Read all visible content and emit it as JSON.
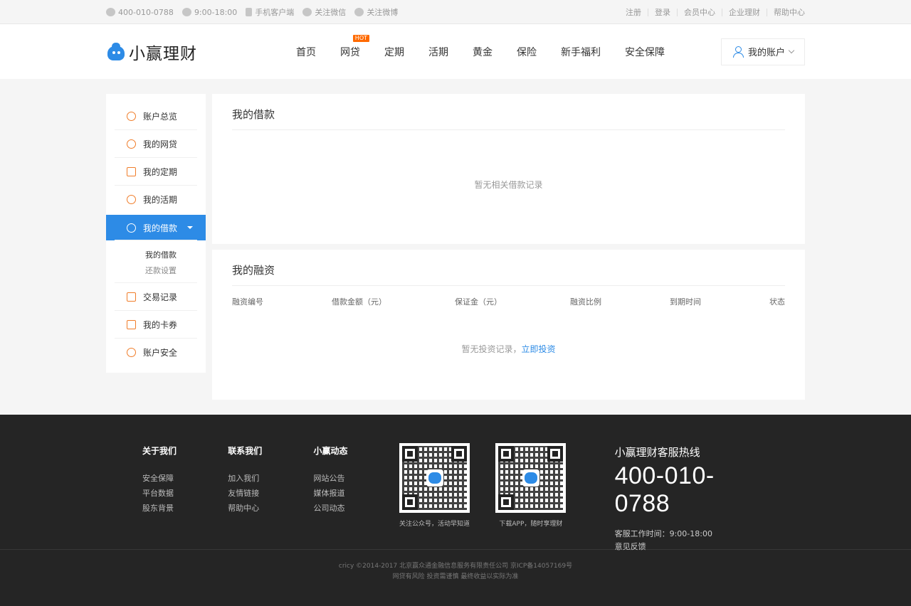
{
  "topbar": {
    "phone": "400-010-0788",
    "hours": "9:00-18:00",
    "mobile_client": "手机客户端",
    "wechat": "关注微信",
    "weibo": "关注微博",
    "links": [
      "注册",
      "登录",
      "会员中心",
      "企业理财",
      "帮助中心"
    ]
  },
  "header": {
    "logo_text": "小赢理财",
    "nav": [
      "首页",
      "网贷",
      "定期",
      "活期",
      "黄金",
      "保险",
      "新手福利",
      "安全保障"
    ],
    "hot_badge": "HOT",
    "account_label": "我的账户"
  },
  "sidebar": {
    "items": [
      "账户总览",
      "我的网贷",
      "我的定期",
      "我的活期",
      "我的借款",
      "交易记录",
      "我的卡券",
      "账户安全"
    ],
    "sub_items": [
      "我的借款",
      "还款设置"
    ]
  },
  "loans_panel": {
    "title": "我的借款",
    "empty_text": "暂无相关借款记录"
  },
  "financing_panel": {
    "title": "我的融资",
    "columns": [
      "融资编号",
      "借款金额（元）",
      "保证金（元）",
      "融资比例",
      "到期时间",
      "状态"
    ],
    "empty_text": "暂无投资记录，",
    "empty_link": "立即投资"
  },
  "footer": {
    "cols": [
      {
        "title": "关于我们",
        "links": [
          "安全保障",
          "平台数据",
          "股东背景"
        ]
      },
      {
        "title": "联系我们",
        "links": [
          "加入我们",
          "友情链接",
          "帮助中心"
        ]
      },
      {
        "title": "小赢动态",
        "links": [
          "网站公告",
          "媒体报道",
          "公司动态"
        ]
      }
    ],
    "qr1_caption": "关注公众号，活动早知道",
    "qr2_caption": "下载APP，随时享理财",
    "hotline_title": "小赢理财客服热线",
    "hotline_number": "400-010-0788",
    "service_hours": "客服工作时间：9:00-18:00",
    "feedback": "意见反馈",
    "copyright": "cricy ©2014-2017 北京赢众通金融信息服务有限责任公司 京ICP备14057169号",
    "risk": "网贷有风险 投资需谨慎 最终收益以实际为准"
  }
}
